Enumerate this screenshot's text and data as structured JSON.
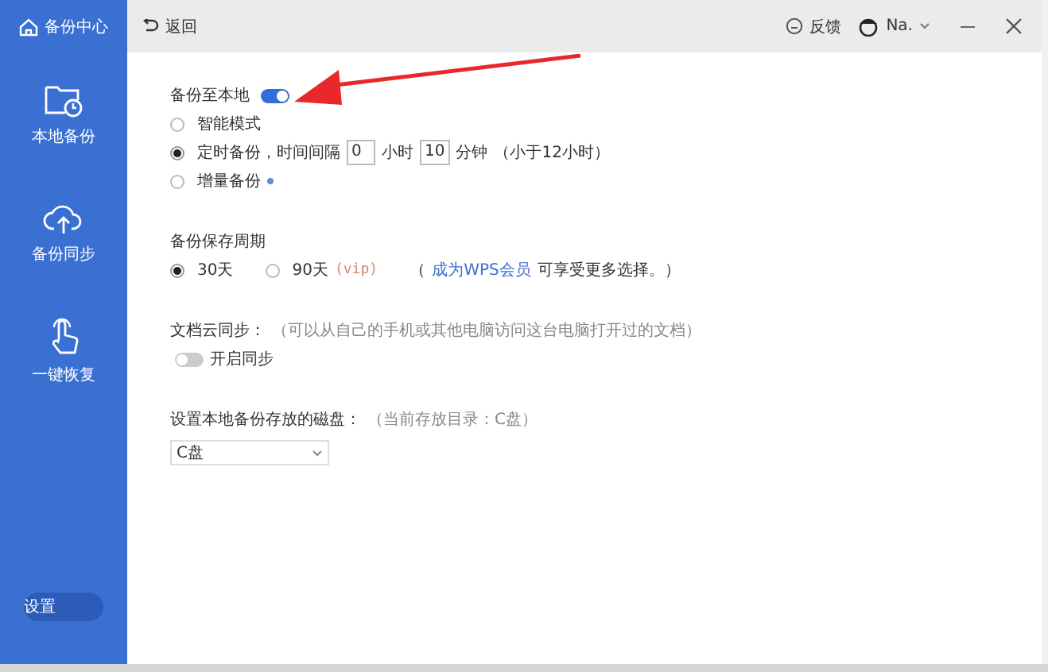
{
  "sidebar": {
    "title": "备份中心",
    "items": [
      {
        "kind": "folder",
        "label": "本地备份"
      },
      {
        "kind": "cloud",
        "label": "备份同步"
      },
      {
        "kind": "hand",
        "label": "一键恢复"
      }
    ],
    "settings_button": "设置"
  },
  "header": {
    "back": "返回",
    "feedback": "反馈",
    "user": "Na."
  },
  "local_backup": {
    "label": "备份至本地",
    "on": true,
    "modes": [
      {
        "kind": "plain",
        "label": "智能模式",
        "selected": false
      },
      {
        "kind": "interval",
        "label": "定时备份，时间间隔",
        "hours": "0",
        "hours_unit": "小时",
        "minutes": "10",
        "minutes_unit": "分钟",
        "note": "（小于12小时）",
        "selected": true
      },
      {
        "kind": "dotted",
        "label": "增量备份",
        "selected": false
      }
    ]
  },
  "retention": {
    "title": "备份保存周期",
    "options": [
      {
        "label": "30天",
        "selected": true
      },
      {
        "label": "90天",
        "tag": "(vip)",
        "selected": false
      }
    ],
    "promo": {
      "open": "（",
      "link": "成为WPS会员",
      "text": "可享受更多选择。）"
    }
  },
  "cloud_sync": {
    "title": "文档云同步：",
    "hint": "（可以从自己的手机或其他电脑访问这台电脑打开过的文档）",
    "toggle": {
      "label": "开启同步",
      "on": false
    }
  },
  "disk": {
    "title": "设置本地备份存放的磁盘：",
    "hint": "（当前存放目录：C盘）",
    "value": "C盘"
  }
}
